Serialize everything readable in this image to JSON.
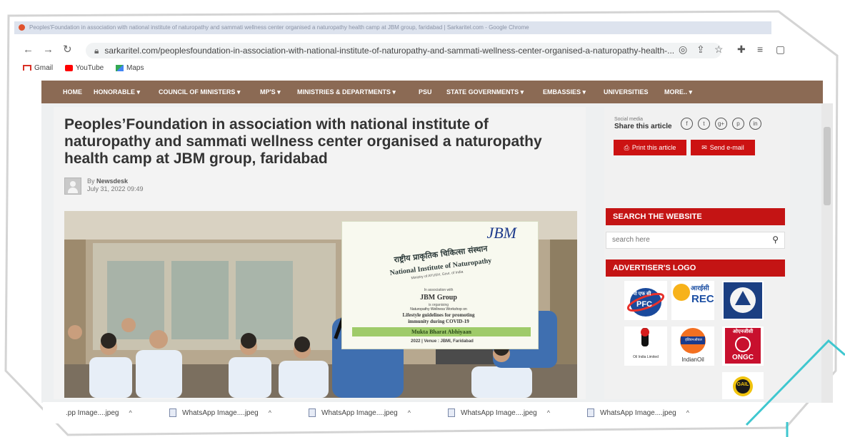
{
  "window": {
    "title": "Peoples'Foundation in association with national institute of naturopathy and sammati wellness center organised a naturopathy health camp at JBM group, faridabad | Sarkaritel.com - Google Chrome"
  },
  "browser": {
    "url": "sarkaritel.com/peoplesfoundation-in-association-with-national-institute-of-naturopathy-and-sammati-wellness-center-organised-a-naturopathy-health-...",
    "bookmarks": [
      "Gmail",
      "YouTube",
      "Maps"
    ]
  },
  "nav": {
    "items": [
      "HOME",
      "HONORABLE ▾",
      "COUNCIL OF MINISTERS ▾",
      "MP'S ▾",
      "MINISTRIES & DEPARTMENTS ▾",
      "PSU",
      "STATE GOVERNMENTS ▾",
      "EMBASSIES ▾",
      "UNIVERSITIES",
      "MORE.. ▾"
    ]
  },
  "article": {
    "title": "Peoples’Foundation in association with national institute of naturopathy and sammati wellness center organised a naturopathy health camp at JBM group, faridabad",
    "by_prefix": "By",
    "author": "Newsdesk",
    "date": "July 31, 2022 09:49"
  },
  "banner": {
    "brand": "JBM",
    "hindi": "राष्ट्रीय प्राकृतिक चिकित्सा संस्थान",
    "institute": "National Institute of Naturopathy",
    "ministry": "Ministry of AYUSH, Govt. of India",
    "assoc": "In association with",
    "group": "JBM Group",
    "organising": "is organising",
    "workshop": "Naturopathy Wellness Workshop on",
    "topic1": "Lifestyle guidelines for promoting",
    "topic2": "immunity during COVID-19",
    "ribbon": "Mukta Bharat Abhiyaan",
    "venue": "2022 | Venue : JBMI, Faridabad"
  },
  "share": {
    "small_label": "Social media",
    "label": "Share this article",
    "icons": [
      "f",
      "t",
      "g+",
      "p",
      "in"
    ],
    "print_label": "Print this article",
    "email_label": "Send e-mail"
  },
  "sidebar": {
    "search_heading": "SEARCH THE WEBSITE",
    "search_placeholder": "search here",
    "advertiser_heading": "ADVERTISER'S LOGO",
    "logos": {
      "pfc": "PFC",
      "pfc_hindi": "पी एफ सी",
      "rec": "REC",
      "rec_hindi": "आरईसी",
      "oil": "Oil India Limited",
      "indianoil": "IndianOil",
      "indianoil_hindi": "इंडियनऑयल",
      "ongc": "ONGC",
      "ongc_hindi": "ओएनजीसी",
      "gail": "GAIL"
    }
  },
  "downloads": {
    "items": [
      ".pp Image....jpeg",
      "WhatsApp Image....jpeg",
      "WhatsApp Image....jpeg",
      "WhatsApp Image....jpeg",
      "WhatsApp Image....jpeg"
    ]
  },
  "colors": {
    "nav_bg": "#8b6a54",
    "accent_red": "#c41414",
    "teal_annotation": "#3fc7cf"
  }
}
